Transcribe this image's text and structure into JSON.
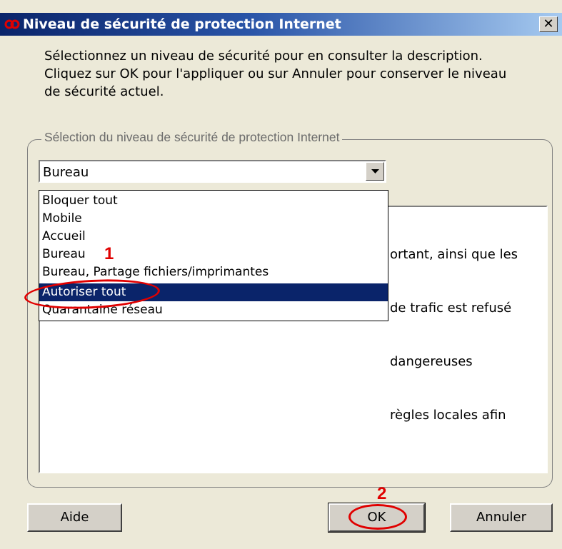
{
  "window": {
    "title": "Niveau de sécurité de protection Internet",
    "close_glyph": "✕",
    "app_icon": "infinity-logo-icon"
  },
  "description": {
    "line1": "Sélectionnez un niveau de sécurité pour en consulter la description.",
    "line2": "Cliquez sur OK pour l'appliquer ou sur Annuler pour conserver le niveau",
    "line3": "de sécurité actuel."
  },
  "group": {
    "legend": "Sélection du niveau de sécurité de protection Internet"
  },
  "select": {
    "value": "Bureau",
    "options": [
      "Bloquer tout",
      "Mobile",
      "Accueil",
      "Bureau",
      "Bureau, Partage fichiers/imprimantes",
      "Autoriser tout",
      "Quarantaine réseau"
    ],
    "highlighted": "Autoriser tout"
  },
  "level_description": {
    "visible_lines": [
      "ortant, ainsi que les",
      "de trafic est refusé",
      "dangereuses",
      "règles locales afin"
    ]
  },
  "buttons": {
    "help": "Aide",
    "ok": "OK",
    "cancel": "Annuler"
  },
  "annotations": {
    "step1": "1",
    "step2": "2",
    "color": "#e00000"
  },
  "colors": {
    "title_bar": "#0a246a",
    "selection": "#0a246a",
    "dialog_bg": "#ece9d8"
  }
}
